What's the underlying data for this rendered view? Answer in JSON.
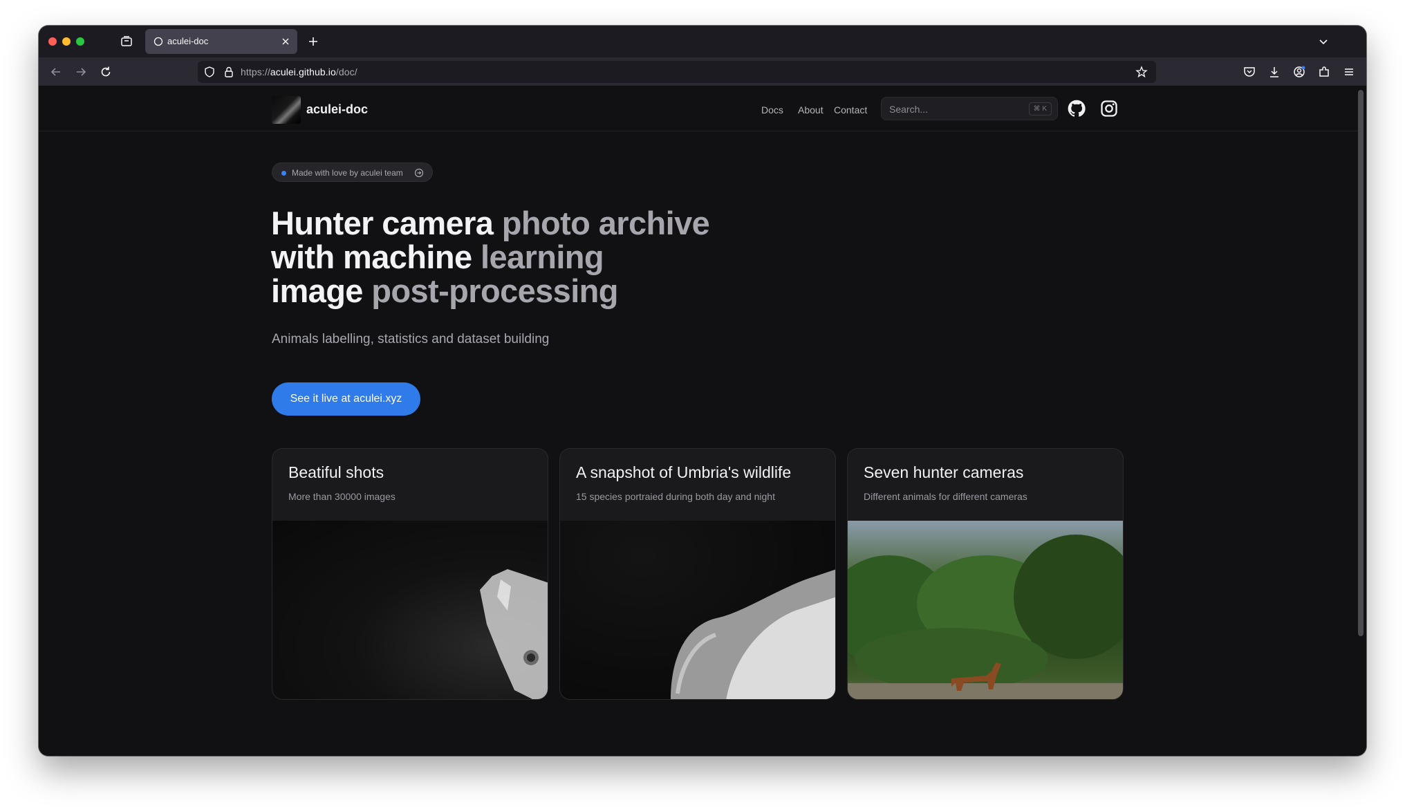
{
  "browser": {
    "tab_title": "aculei-doc",
    "url_prefix": "https://",
    "url_domain": "aculei.github.io",
    "url_path": "/doc/"
  },
  "site": {
    "brand": "aculei-doc",
    "nav": [
      "Docs",
      "About",
      "Contact"
    ],
    "search_placeholder": "Search...",
    "search_shortcut": "⌘ K"
  },
  "hero": {
    "pill": "Made with love by aculei team",
    "title_line1_a": "Hunter camera ",
    "title_line1_b": "photo archive",
    "title_line2_a": "with machine ",
    "title_line2_b": "learning",
    "title_line3_a": "image ",
    "title_line3_b": "post-processing",
    "subtitle": "Animals labelling, statistics and dataset building",
    "cta": "See it live at aculei.xyz"
  },
  "cards": [
    {
      "title": "Beatiful shots",
      "desc": "More than 30000 images"
    },
    {
      "title": "A snapshot of Umbria's wildlife",
      "desc": "15 species portraied during both day and night"
    },
    {
      "title": "Seven hunter cameras",
      "desc": "Different animals for different cameras"
    }
  ],
  "colors": {
    "accent": "#2f7bea",
    "background": "#111113"
  }
}
